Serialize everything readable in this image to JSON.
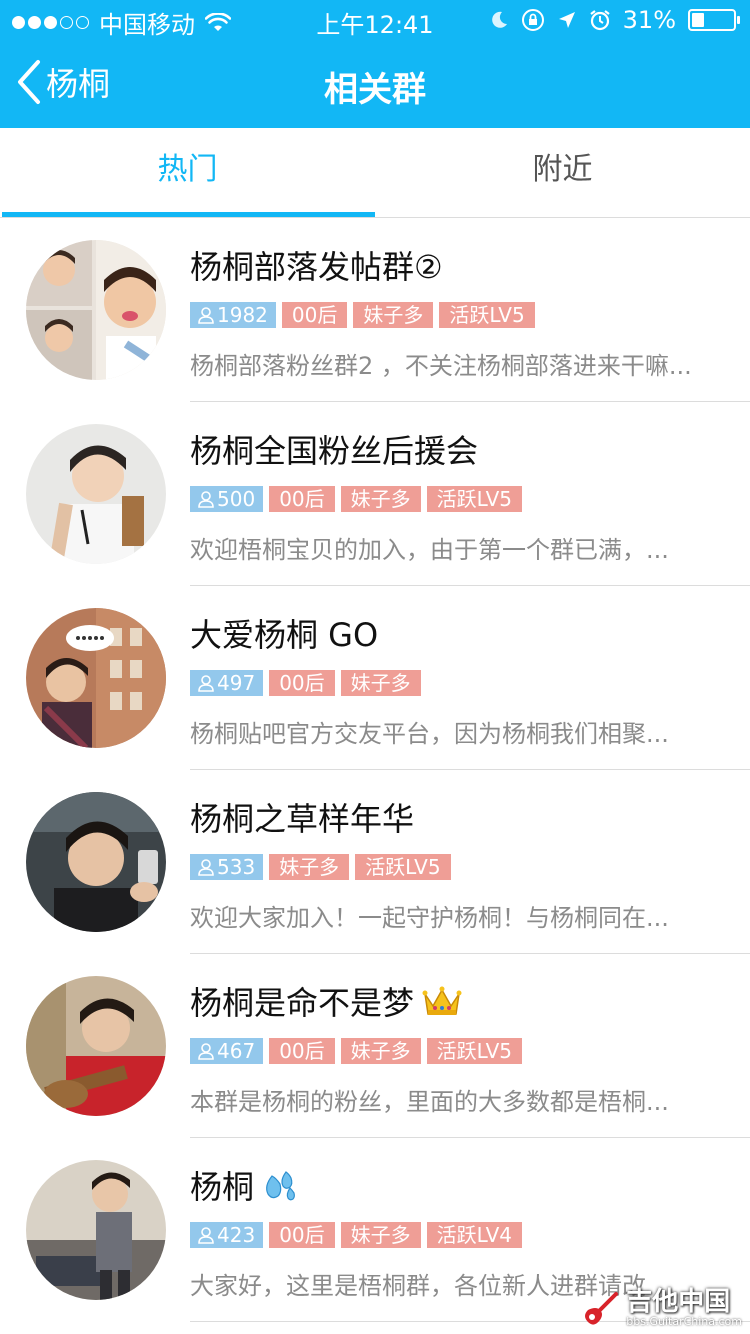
{
  "status_bar": {
    "carrier": "中国移动",
    "time": "上午12:41",
    "battery_percent": "31%",
    "battery_level": 0.31,
    "icons": [
      "signal-dots",
      "wifi-icon",
      "moon-icon",
      "rotation-lock-icon",
      "location-arrow-icon",
      "alarm-icon",
      "battery-icon"
    ]
  },
  "nav": {
    "back_label": "杨桐",
    "title": "相关群"
  },
  "tabs": [
    {
      "label": "热门",
      "active": true
    },
    {
      "label": "附近",
      "active": false
    }
  ],
  "groups": [
    {
      "name": "杨桐部落发帖群②",
      "emoji": "",
      "count": "1982",
      "tags": [
        "00后",
        "妹子多",
        "活跃LV5"
      ],
      "desc": "杨桐部落粉丝群2 ，不关注杨桐部落进来干嘛..."
    },
    {
      "name": "杨桐全国粉丝后援会",
      "emoji": "",
      "count": "500",
      "tags": [
        "00后",
        "妹子多",
        "活跃LV5"
      ],
      "desc": "欢迎梧桐宝贝的加入，由于第一个群已满，..."
    },
    {
      "name": "大爱杨桐 GO",
      "emoji": "",
      "count": "497",
      "tags": [
        "00后",
        "妹子多"
      ],
      "desc": "杨桐贴吧官方交友平台，因为杨桐我们相聚..."
    },
    {
      "name": "杨桐之草样年华",
      "emoji": "",
      "count": "533",
      "tags": [
        "妹子多",
        "活跃LV5"
      ],
      "desc": "欢迎大家加入！一起守护杨桐！与杨桐同在..."
    },
    {
      "name": "杨桐是命不是梦",
      "emoji": "crown-icon",
      "count": "467",
      "tags": [
        "00后",
        "妹子多",
        "活跃LV5"
      ],
      "desc": "本群是杨桐的粉丝，里面的大多数都是梧桐..."
    },
    {
      "name": "杨桐",
      "emoji": "sweat-droplets-icon",
      "count": "423",
      "tags": [
        "00后",
        "妹子多",
        "活跃LV4"
      ],
      "desc": "大家好，这里是梧桐群，各位新人进群请改"
    }
  ],
  "watermark": {
    "main": "吉他中国",
    "sub": "bbs.GuitarChina.com"
  },
  "colors": {
    "brand": "#12b7f5",
    "tag_count": "#93c8ec",
    "tag_pink": "#ef9e96",
    "desc_text": "#8b8b8b"
  }
}
